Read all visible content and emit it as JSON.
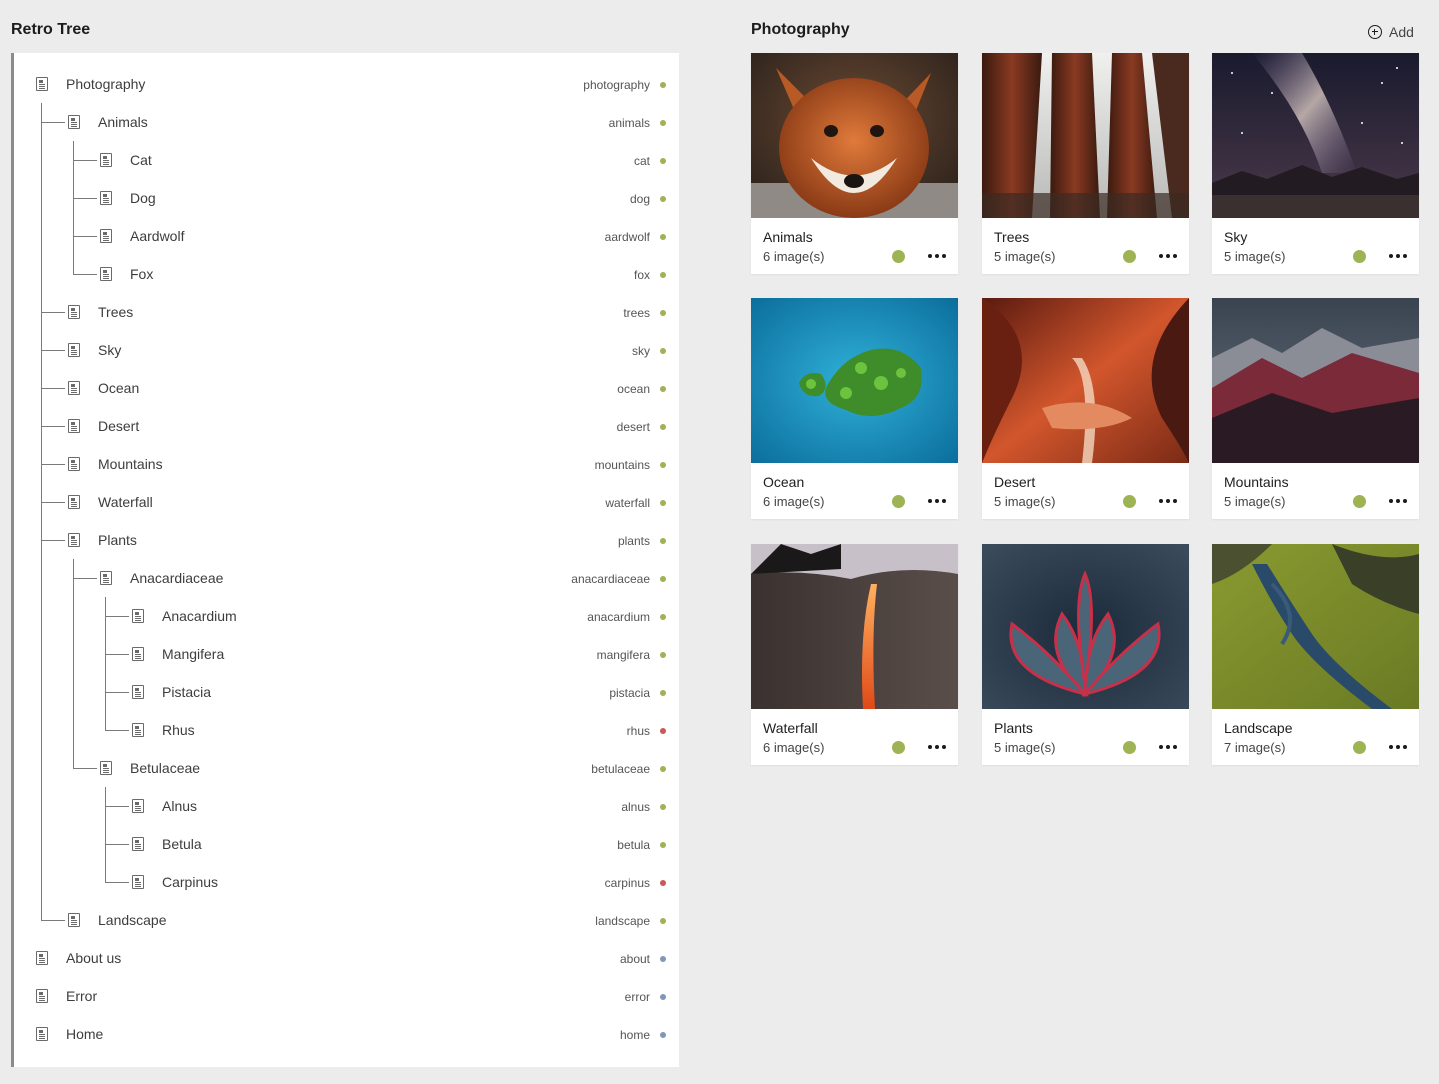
{
  "left_panel": {
    "title": "Retro Tree"
  },
  "tree": [
    {
      "label": "Photography",
      "slug": "photography",
      "status": "green",
      "depth": 0
    },
    {
      "label": "Animals",
      "slug": "animals",
      "status": "green",
      "depth": 1
    },
    {
      "label": "Cat",
      "slug": "cat",
      "status": "green",
      "depth": 2
    },
    {
      "label": "Dog",
      "slug": "dog",
      "status": "green",
      "depth": 2
    },
    {
      "label": "Aardwolf",
      "slug": "aardwolf",
      "status": "green",
      "depth": 2
    },
    {
      "label": "Fox",
      "slug": "fox",
      "status": "green",
      "depth": 2
    },
    {
      "label": "Trees",
      "slug": "trees",
      "status": "green",
      "depth": 1
    },
    {
      "label": "Sky",
      "slug": "sky",
      "status": "green",
      "depth": 1
    },
    {
      "label": "Ocean",
      "slug": "ocean",
      "status": "green",
      "depth": 1
    },
    {
      "label": "Desert",
      "slug": "desert",
      "status": "green",
      "depth": 1
    },
    {
      "label": "Mountains",
      "slug": "mountains",
      "status": "green",
      "depth": 1
    },
    {
      "label": "Waterfall",
      "slug": "waterfall",
      "status": "green",
      "depth": 1
    },
    {
      "label": "Plants",
      "slug": "plants",
      "status": "green",
      "depth": 1
    },
    {
      "label": "Anacardiaceae",
      "slug": "anacardiaceae",
      "status": "green",
      "depth": 2
    },
    {
      "label": "Anacardium",
      "slug": "anacardium",
      "status": "green",
      "depth": 3
    },
    {
      "label": "Mangifera",
      "slug": "mangifera",
      "status": "green",
      "depth": 3
    },
    {
      "label": "Pistacia",
      "slug": "pistacia",
      "status": "green",
      "depth": 3
    },
    {
      "label": "Rhus",
      "slug": "rhus",
      "status": "red",
      "depth": 3
    },
    {
      "label": "Betulaceae",
      "slug": "betulaceae",
      "status": "green",
      "depth": 2
    },
    {
      "label": "Alnus",
      "slug": "alnus",
      "status": "green",
      "depth": 3
    },
    {
      "label": "Betula",
      "slug": "betula",
      "status": "green",
      "depth": 3
    },
    {
      "label": "Carpinus",
      "slug": "carpinus",
      "status": "red",
      "depth": 3
    },
    {
      "label": "Landscape",
      "slug": "landscape",
      "status": "green",
      "depth": 1
    },
    {
      "label": "About us",
      "slug": "about",
      "status": "blue",
      "depth": 0
    },
    {
      "label": "Error",
      "slug": "error",
      "status": "blue",
      "depth": 0
    },
    {
      "label": "Home",
      "slug": "home",
      "status": "blue",
      "depth": 0
    }
  ],
  "status_colors": {
    "green": "#9db354",
    "red": "#cc5555",
    "blue": "#7f97b8"
  },
  "right_panel": {
    "title": "Photography",
    "add_label": "Add",
    "cards": [
      {
        "title": "Animals",
        "count": "6 image(s)",
        "image": "fox-photo"
      },
      {
        "title": "Trees",
        "count": "5 image(s)",
        "image": "redwood-trees-photo"
      },
      {
        "title": "Sky",
        "count": "5 image(s)",
        "image": "milky-way-photo"
      },
      {
        "title": "Ocean",
        "count": "6 image(s)",
        "image": "island-aerial-photo"
      },
      {
        "title": "Desert",
        "count": "5 image(s)",
        "image": "slot-canyon-photo"
      },
      {
        "title": "Mountains",
        "count": "5 image(s)",
        "image": "red-mountains-photo"
      },
      {
        "title": "Waterfall",
        "count": "6 image(s)",
        "image": "firefall-photo"
      },
      {
        "title": "Plants",
        "count": "5 image(s)",
        "image": "succulent-photo"
      },
      {
        "title": "Landscape",
        "count": "7 image(s)",
        "image": "river-valley-photo"
      }
    ]
  }
}
